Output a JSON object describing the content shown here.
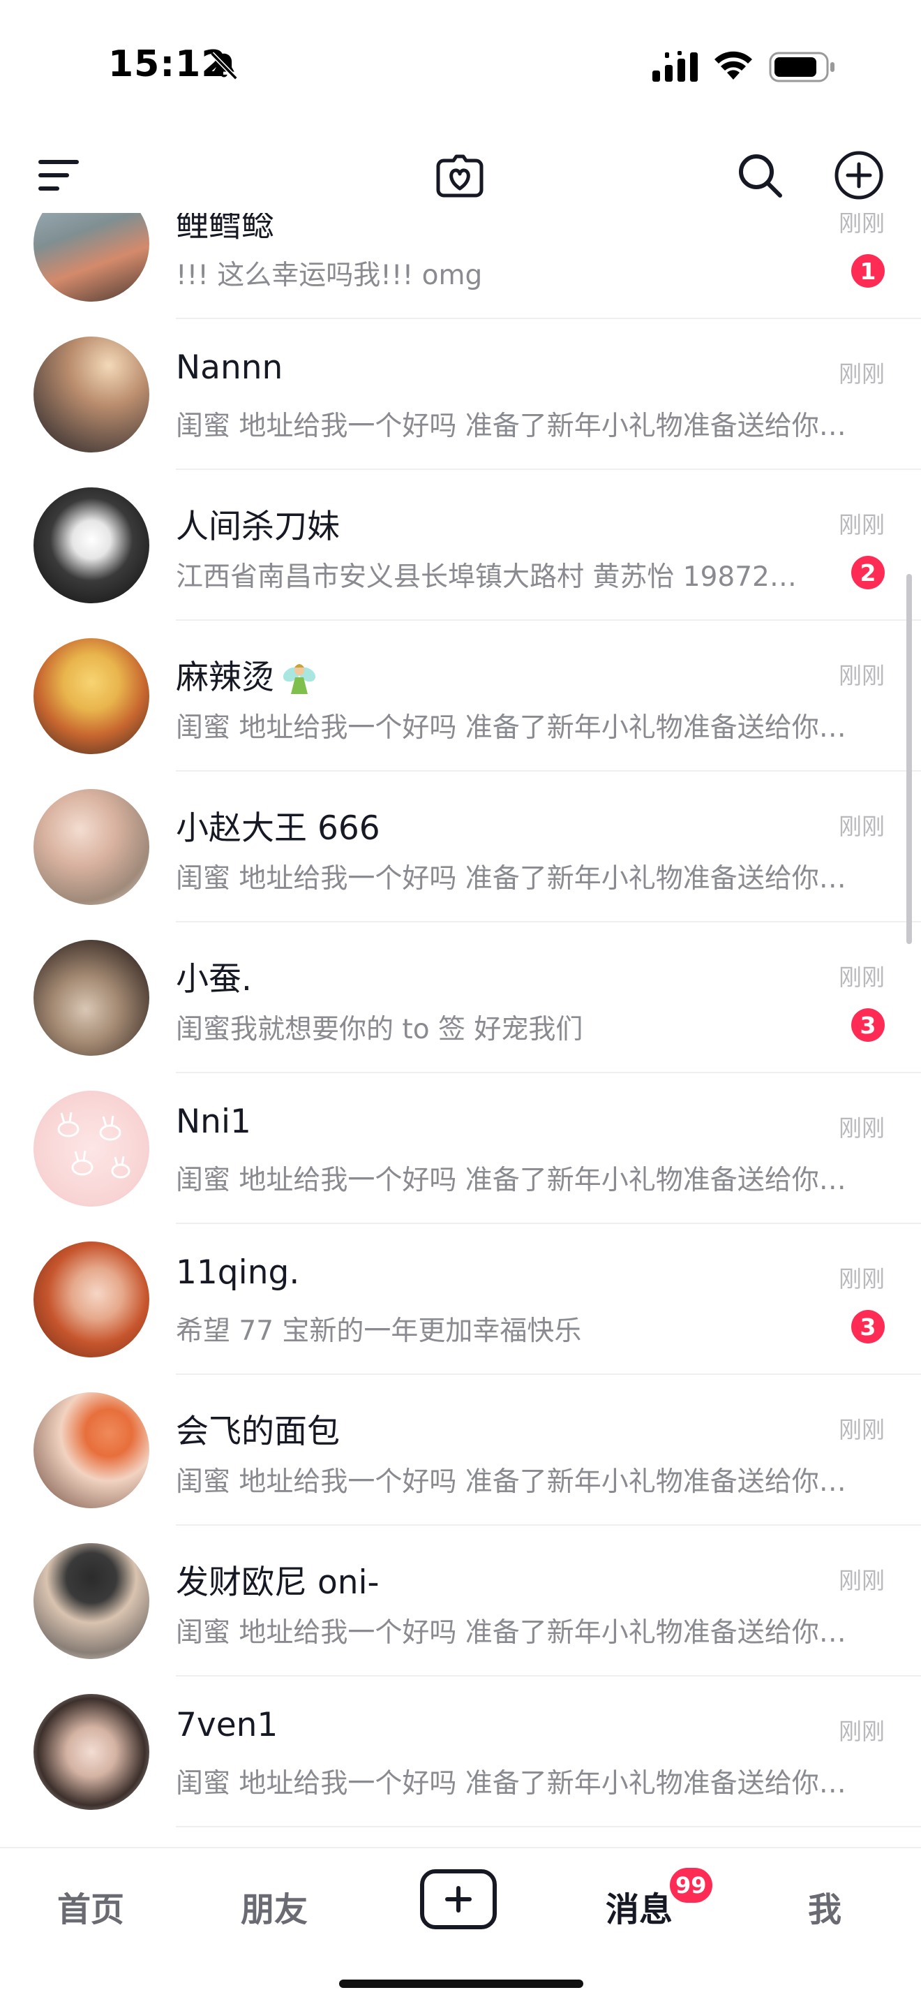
{
  "status_bar": {
    "time": "15:12"
  },
  "header": {
    "icons": [
      "menu-icon",
      "heart-frame-icon",
      "search-icon",
      "add-circle-icon"
    ]
  },
  "messages": [
    {
      "name": "鲤鳕鲶",
      "time": "刚刚",
      "preview": "!!! 这么幸运吗我!!! omg",
      "badge": "1"
    },
    {
      "name": "Nannn",
      "time": "刚刚",
      "preview": "闺蜜 地址给我一个好吗 准备了新年小礼物准备送给你…",
      "badge": ""
    },
    {
      "name": "人间杀刀妹",
      "time": "刚刚",
      "preview": "江西省南昌市安义县长埠镇大路村 黄苏怡 19872…",
      "badge": "2"
    },
    {
      "name": "麻辣烫",
      "time": "刚刚",
      "preview": "闺蜜 地址给我一个好吗 准备了新年小礼物准备送给你…",
      "badge": "",
      "emoji": "fairy-icon"
    },
    {
      "name": "小赵大王 666",
      "time": "刚刚",
      "preview": "闺蜜 地址给我一个好吗 准备了新年小礼物准备送给你…",
      "badge": ""
    },
    {
      "name": "小蚕.",
      "time": "刚刚",
      "preview": "闺蜜我就想要你的 to 签 好宠我们",
      "badge": "3"
    },
    {
      "name": "Nni1",
      "time": "刚刚",
      "preview": "闺蜜 地址给我一个好吗 准备了新年小礼物准备送给你…",
      "badge": ""
    },
    {
      "name": "11qing.",
      "time": "刚刚",
      "preview": "希望 77 宝新的一年更加幸福快乐",
      "badge": "3"
    },
    {
      "name": "会飞的面包",
      "time": "刚刚",
      "preview": "闺蜜 地址给我一个好吗 准备了新年小礼物准备送给你…",
      "badge": ""
    },
    {
      "name": "发财欧尼 oni-",
      "time": "刚刚",
      "preview": "闺蜜 地址给我一个好吗 准备了新年小礼物准备送给你…",
      "badge": ""
    },
    {
      "name": "7ven1",
      "time": "刚刚",
      "preview": "闺蜜 地址给我一个好吗 准备了新年小礼物准备送给你…",
      "badge": ""
    }
  ],
  "tabs": {
    "home": "首页",
    "friends": "朋友",
    "messages": "消息",
    "me": "我",
    "messages_badge": "99"
  },
  "colors": {
    "badge": "#fe2c55",
    "text_primary": "#161823",
    "text_secondary": "#8a8b91",
    "time_label": "#b9b9bd"
  }
}
